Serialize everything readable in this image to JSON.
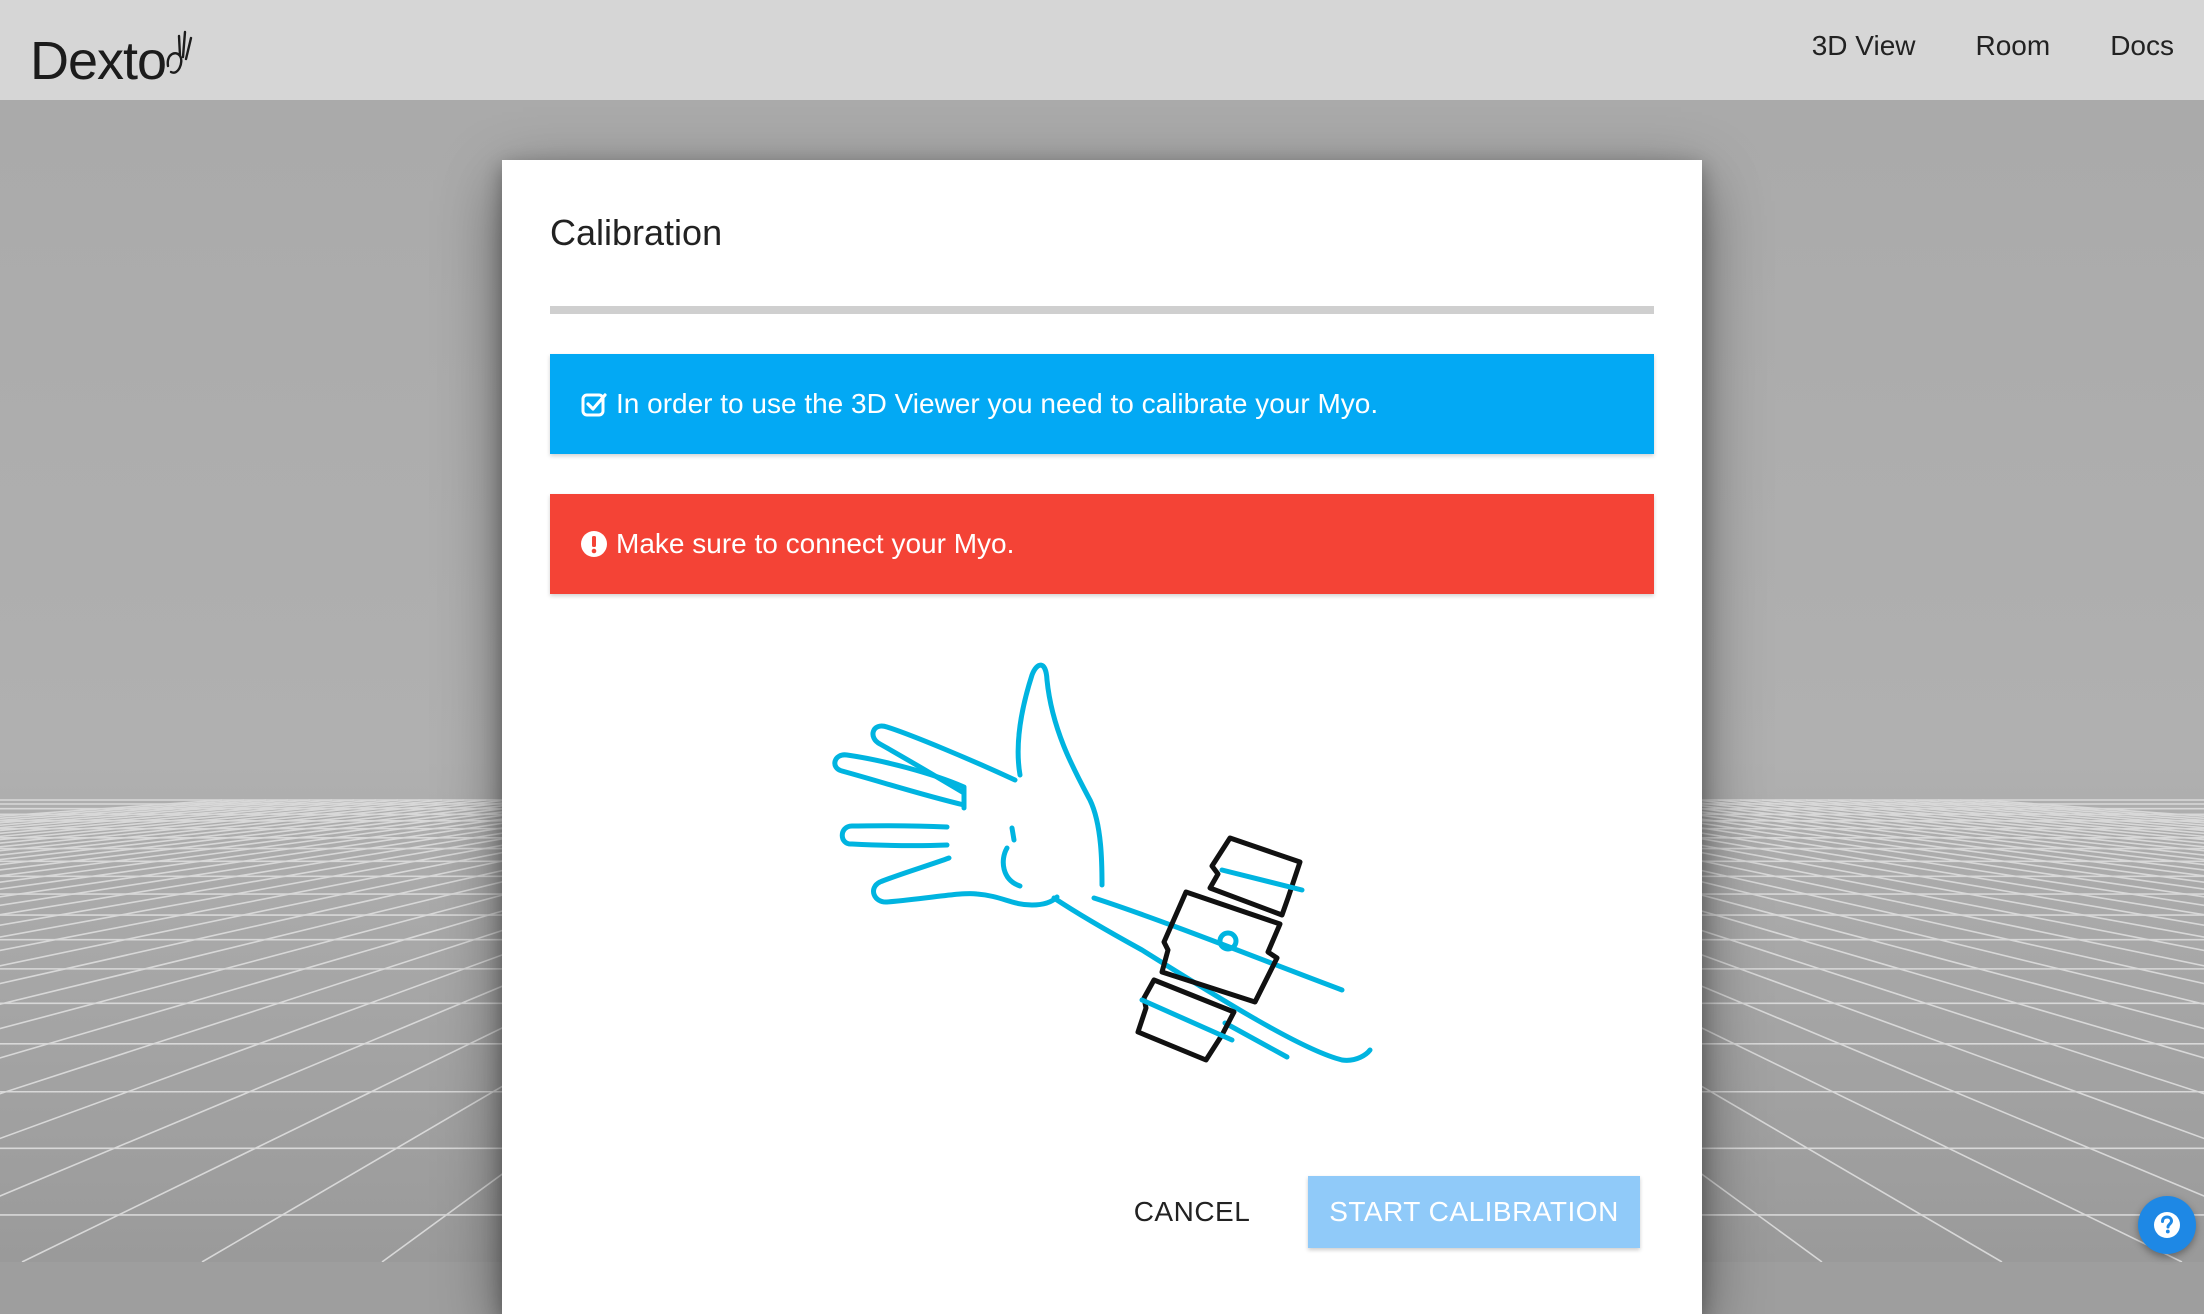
{
  "app": {
    "brand": "Dexto"
  },
  "nav": {
    "items": [
      "3D View",
      "Room",
      "Docs"
    ]
  },
  "dialog": {
    "title": "Calibration",
    "progress_percent": 0,
    "info_message": "In order to use the 3D Viewer you need to calibrate your Myo.",
    "error_message": "Make sure to connect your Myo.",
    "cancel_label": "CANCEL",
    "start_label": "START CALIBRATION"
  },
  "icons": {
    "info": "check-square-icon",
    "error": "exclamation-circle-icon",
    "help": "question-circle-icon",
    "logo": "hand-gesture-icon"
  },
  "colors": {
    "info": "#03a9f4",
    "error": "#f44336",
    "start_button_disabled": "#90caf9",
    "illustration_arm": "#00b4e0",
    "help_fab": "#1e88e5"
  }
}
